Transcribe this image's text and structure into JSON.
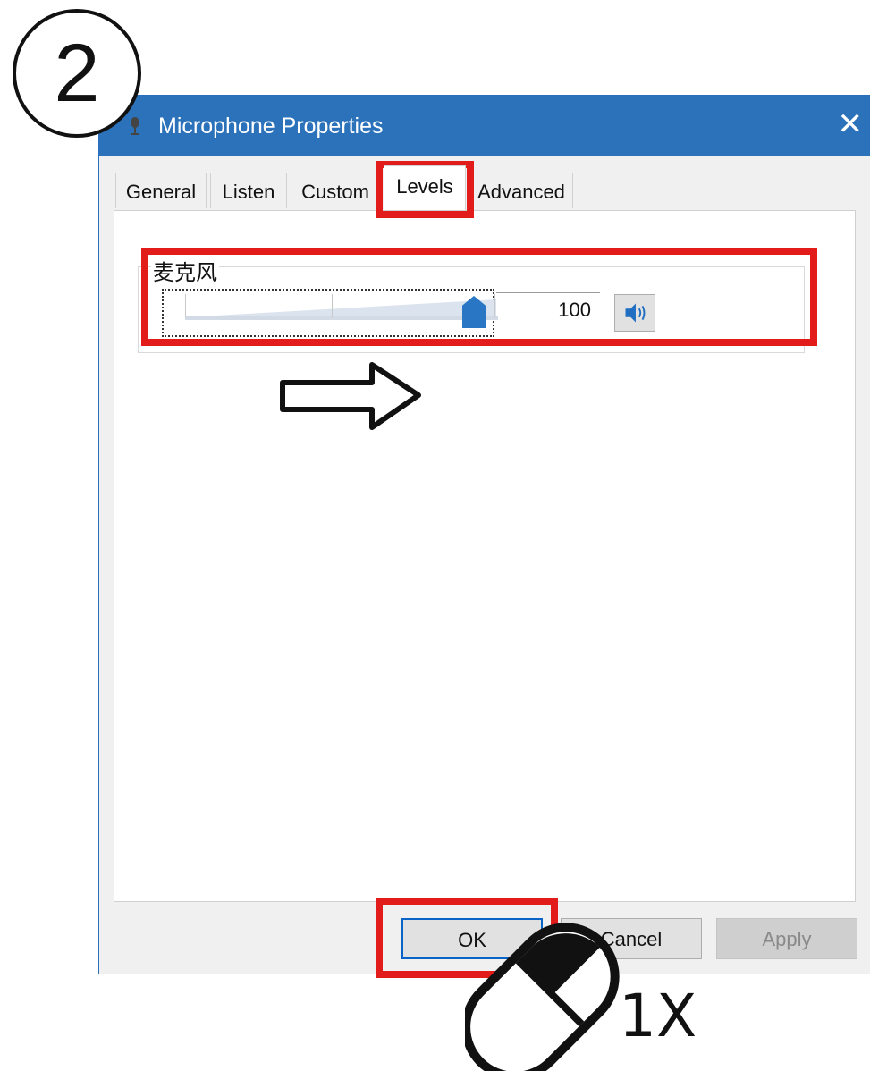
{
  "step": {
    "number": "2"
  },
  "window": {
    "title": "Microphone Properties",
    "close_glyph": "✕",
    "icon": "microphone-icon"
  },
  "tabs": [
    {
      "label": "General"
    },
    {
      "label": "Listen"
    },
    {
      "label": "Custom"
    },
    {
      "label": "Levels",
      "active": true
    },
    {
      "label": "Advanced"
    }
  ],
  "levels": {
    "group_label": "麦克风",
    "volume_value": "100",
    "slider_level_percent": 100,
    "mute_icon": "speaker-icon"
  },
  "buttons": {
    "ok": "OK",
    "cancel": "Cancel",
    "apply": "Apply"
  },
  "annotations": {
    "click_count": "1X",
    "highlight_color": "#e21b1b",
    "arrow_icon": "right-arrow-icon",
    "mouse_icon": "mouse-left-click-icon"
  },
  "colors": {
    "titlebar": "#2b72bb",
    "slider_thumb": "#2876c4"
  }
}
